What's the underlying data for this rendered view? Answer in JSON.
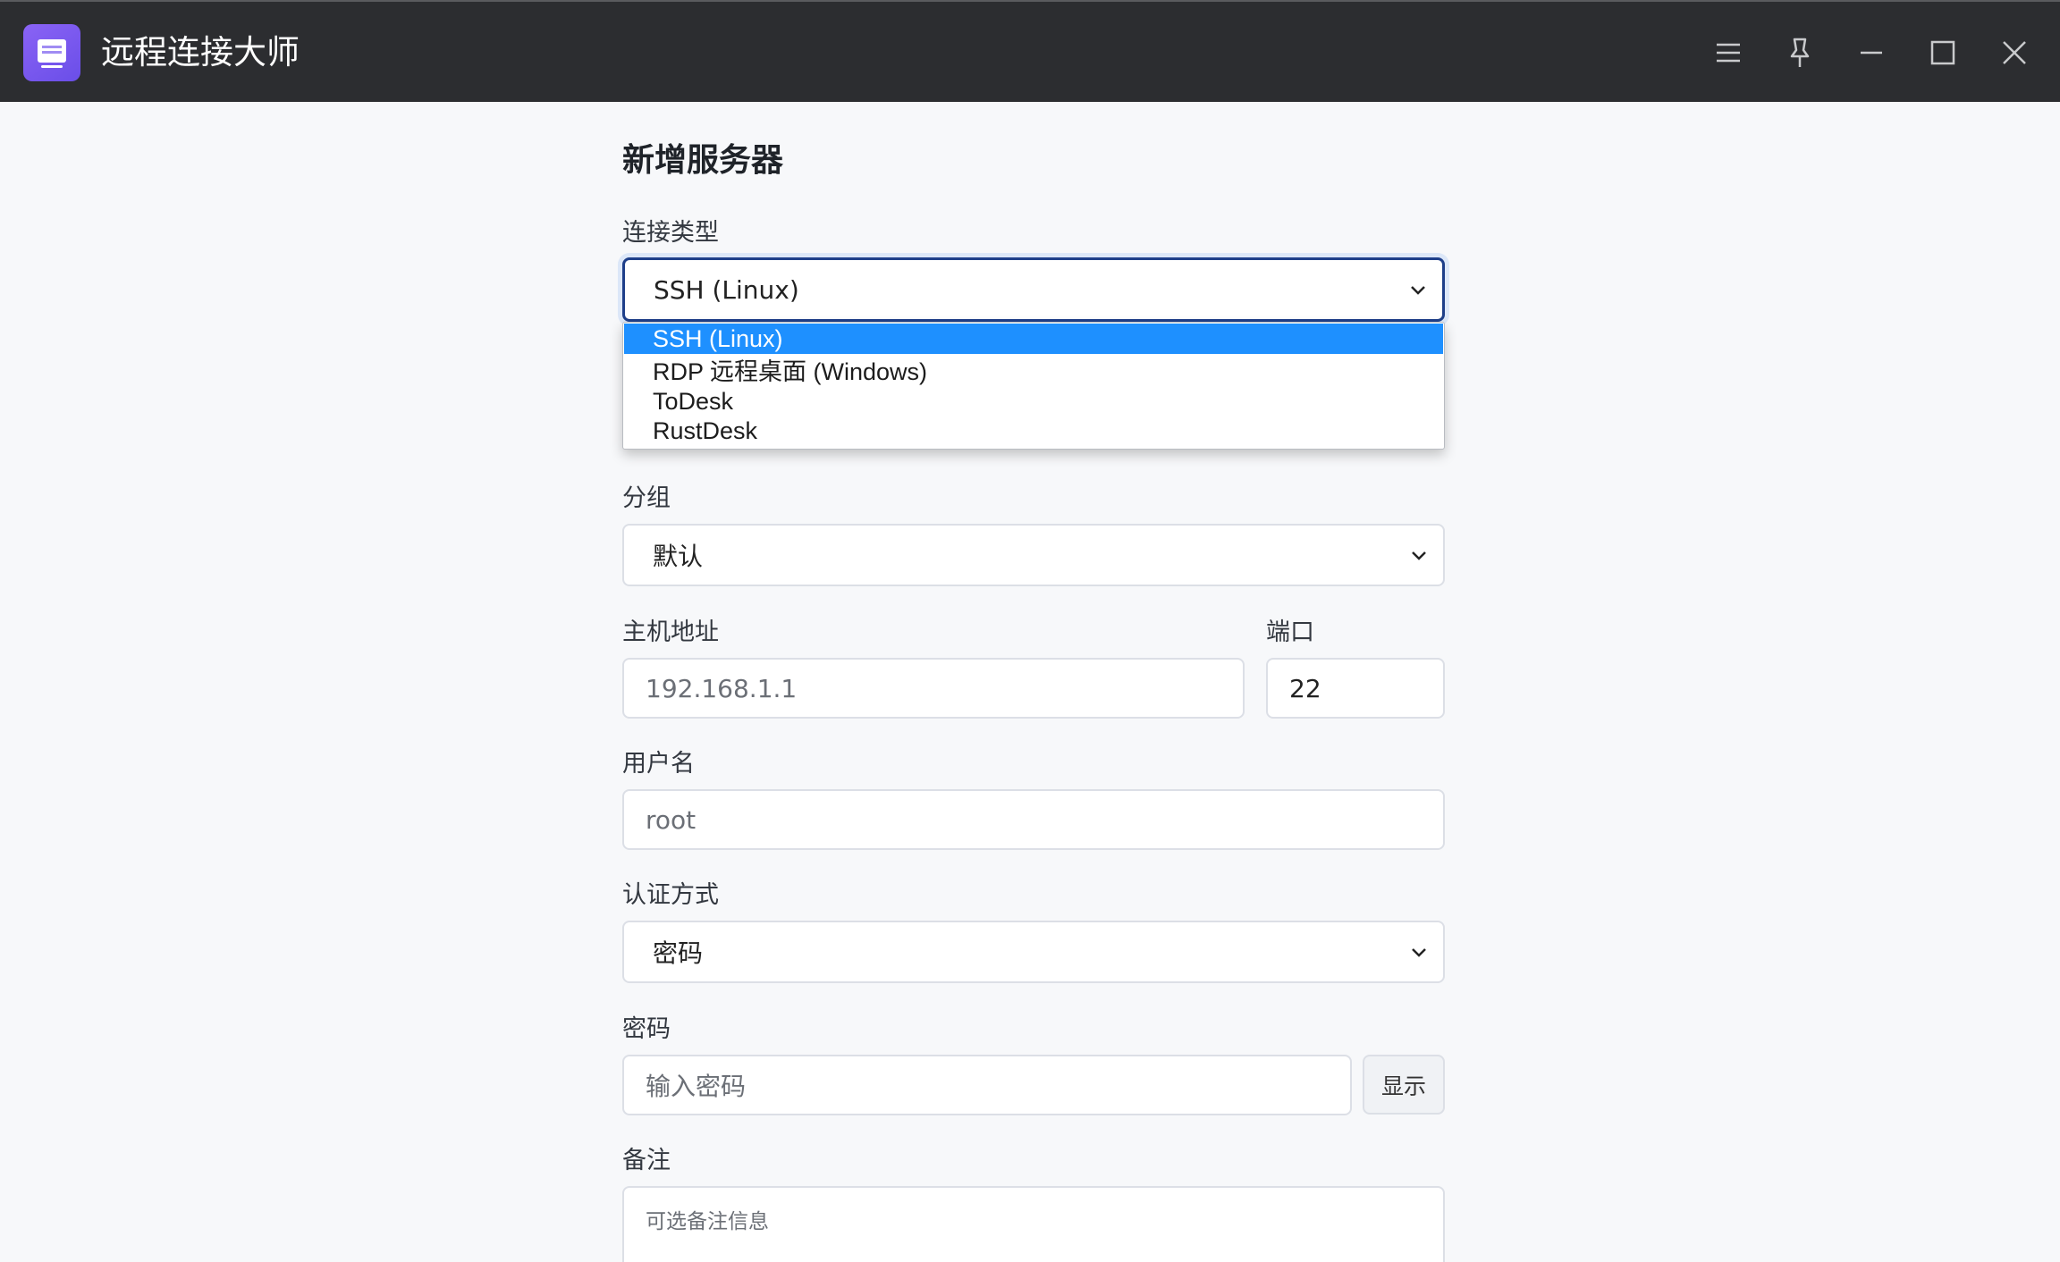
{
  "app": {
    "title": "远程连接大师",
    "icon": "monitor-icon",
    "accent": "#7b5cf0"
  },
  "window_controls": [
    "menu-icon",
    "pin-icon",
    "minimize-icon",
    "maximize-icon",
    "close-icon"
  ],
  "form": {
    "title": "新增服务器",
    "connection_type": {
      "label": "连接类型",
      "value": "SSH (Linux)",
      "options": [
        "SSH (Linux)",
        "RDP 远程桌面 (Windows)",
        "ToDesk",
        "RustDesk"
      ],
      "selected_index": 0
    },
    "group": {
      "label": "分组",
      "value": "默认"
    },
    "host": {
      "label": "主机地址",
      "placeholder": "192.168.1.1"
    },
    "port": {
      "label": "端口",
      "value": "22"
    },
    "username": {
      "label": "用户名",
      "placeholder": "root"
    },
    "auth_method": {
      "label": "认证方式",
      "value": "密码"
    },
    "password": {
      "label": "密码",
      "placeholder": "输入密码",
      "show_label": "显示"
    },
    "notes": {
      "label": "备注",
      "placeholder": "可选备注信息"
    }
  },
  "colors": {
    "titlebar": "#2c2d30",
    "option_highlight": "#1e90ff",
    "focus_border": "#1e3f8a"
  }
}
